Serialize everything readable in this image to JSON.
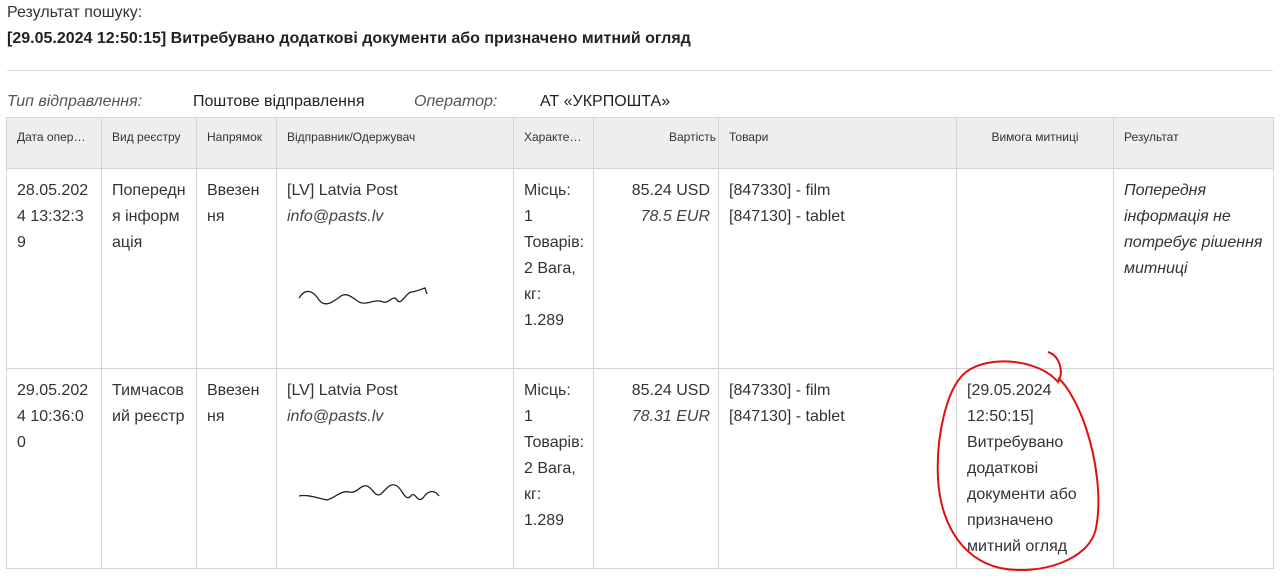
{
  "header": {
    "result_label": "Результат пошуку:",
    "result_title": "[29.05.2024 12:50:15] Витребувано додаткові документи або призначено митний огляд"
  },
  "meta": {
    "type_label": "Тип відправлення:",
    "type_value": "Поштове відправлення",
    "operator_label": "Оператор:",
    "operator_value": "АТ «УКРПОШТА»"
  },
  "table": {
    "columns": [
      "Дата операції",
      "Вид реєстру",
      "Напрямок",
      "Відправник/Одержувач",
      "Характе…",
      "Вартість",
      "Товари",
      "Вимога митниці",
      "Результат"
    ],
    "rows": [
      {
        "date": "28.05.2024 13:32:39",
        "register": "Попередня інформація",
        "direction": "Ввезення",
        "sender": "[LV] Latvia Post",
        "email": "info@pasts.lv",
        "chars": "Місць: 1 Товарів: 2 Вага, кг: 1.289",
        "value_usd": "85.24 USD",
        "value_eur": "78.5 EUR",
        "goods": [
          "[847330] - film",
          "[847130] - tablet"
        ],
        "customs": "",
        "result": "Попередня інформація не потребує рішення митниці"
      },
      {
        "date": "29.05.2024 10:36:00",
        "register": "Тимчасовий реєстр",
        "direction": "Ввезення",
        "sender": "[LV] Latvia Post",
        "email": "info@pasts.lv",
        "chars": "Місць: 1 Товарів: 2 Вага, кг: 1.289",
        "value_usd": "85.24 USD",
        "value_eur": "78.31 EUR",
        "goods": [
          "[847330] - film",
          "[847130] - tablet"
        ],
        "customs": "[29.05.2024 12:50:15] Витребувано додаткові документи або призначено митний огляд",
        "result": ""
      }
    ]
  },
  "colors": {
    "header_bg": "#eeeeee",
    "border": "#d5d5d5",
    "annotation": "#e01010"
  }
}
